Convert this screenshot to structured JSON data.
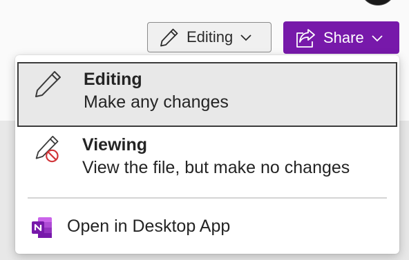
{
  "toolbar": {
    "editing_label": "Editing",
    "share_label": "Share",
    "accent_color": "#7719aa"
  },
  "menu": {
    "items": [
      {
        "title": "Editing",
        "subtitle": "Make any changes",
        "icon": "pencil-icon",
        "selected": true
      },
      {
        "title": "Viewing",
        "subtitle": "View the file, but make no changes",
        "icon": "pencil-blocked-icon",
        "selected": false
      }
    ],
    "desktop_label": "Open in Desktop App",
    "desktop_icon": "onenote-icon"
  }
}
